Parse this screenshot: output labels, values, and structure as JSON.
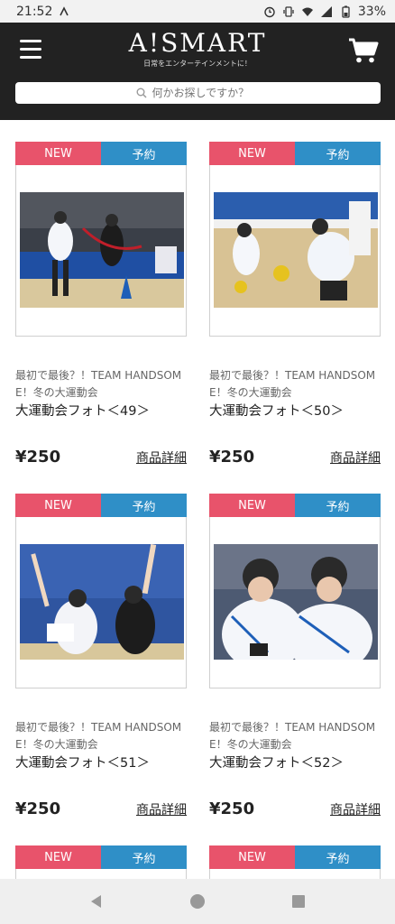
{
  "status_bar": {
    "time": "21:52",
    "battery": "33%"
  },
  "header": {
    "logo": "A!SMART",
    "tagline": "日常をエンターテインメントに！",
    "search_placeholder": "何かお探しですか？"
  },
  "badges": {
    "new": "NEW",
    "reserve": "予約"
  },
  "products": [
    {
      "series": "最初で最後？！TEAM HANDSOME！冬の大運動会",
      "series_line1": "最初で最後？！TEAM HANDSOM",
      "series_line2": "E！冬の大運動会",
      "name": "大運動会フォト＜49＞",
      "price": "¥250",
      "detail": "商品詳細"
    },
    {
      "series": "最初で最後？！TEAM HANDSOME！冬の大運動会",
      "series_line1": "最初で最後？！TEAM HANDSOM",
      "series_line2": "E！冬の大運動会",
      "name": "大運動会フォト＜50＞",
      "price": "¥250",
      "detail": "商品詳細"
    },
    {
      "series": "最初で最後？！TEAM HANDSOME！冬の大運動会",
      "series_line1": "最初で最後？！TEAM HANDSOM",
      "series_line2": "E！冬の大運動会",
      "name": "大運動会フォト＜51＞",
      "price": "¥250",
      "detail": "商品詳細"
    },
    {
      "series": "最初で最後？！TEAM HANDSOME！冬の大運動会",
      "series_line1": "最初で最後？！TEAM HANDSOM",
      "series_line2": "E！冬の大運動会",
      "name": "大運動会フォト＜52＞",
      "price": "¥250",
      "detail": "商品詳細"
    }
  ],
  "icons": {
    "menu": "hamburger-icon",
    "cart": "cart-icon",
    "search": "search-icon",
    "nav_back": "triangle-back-icon",
    "nav_home": "circle-home-icon",
    "nav_recents": "square-recents-icon"
  },
  "colors": {
    "header_bg": "#222222",
    "badge_new": "#e8536b",
    "badge_reserve": "#2f8fc7"
  }
}
